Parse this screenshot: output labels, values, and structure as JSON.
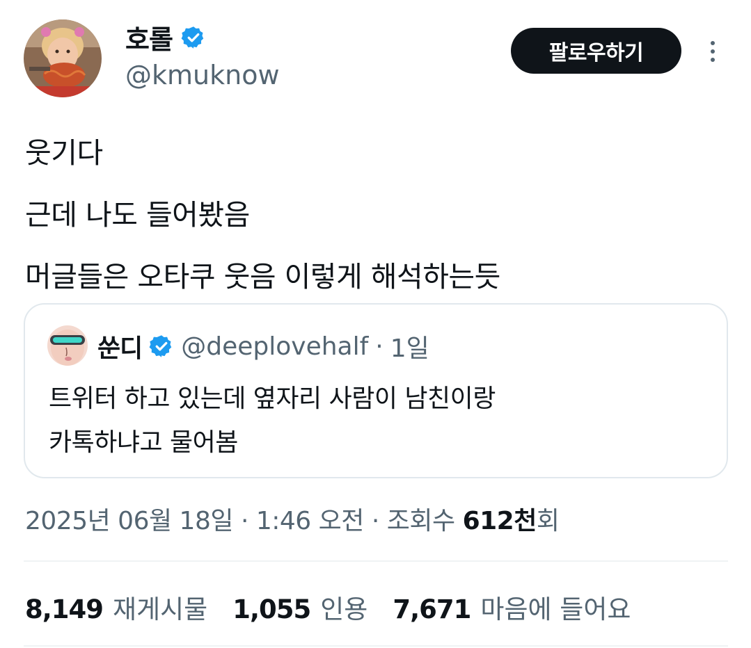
{
  "author": {
    "display_name": "호롤",
    "handle": "@kmuknow",
    "verified_icon": "verified-badge-icon"
  },
  "follow_label": "팔로우하기",
  "tweet_lines": [
    "웃기다",
    "근데 나도 들어봤음",
    "머글들은 오타쿠 웃음 이렇게 해석하는듯"
  ],
  "quote": {
    "display_name": "쑨디",
    "handle": "@deeplovehalf",
    "separator": "·",
    "time": "1일",
    "lines": [
      "트위터 하고 있는데 옆자리 사람이 남친이랑",
      "카톡하냐고 물어봄"
    ]
  },
  "meta": {
    "date": "2025년 06월 18일",
    "sep1": "·",
    "time": "1:46 오전",
    "sep2": "·",
    "views_label": "조회수",
    "views_number": "612천",
    "views_suffix": "회"
  },
  "stats": {
    "reposts_count": "8,149",
    "reposts_label": "재게시물",
    "quotes_count": "1,055",
    "quotes_label": "인용",
    "likes_count": "7,671",
    "likes_label": "마음에 들어요"
  },
  "colors": {
    "text": "#0f1419",
    "secondary": "#536471",
    "verified": "#1d9bf0",
    "border": "#e1e8ed"
  }
}
